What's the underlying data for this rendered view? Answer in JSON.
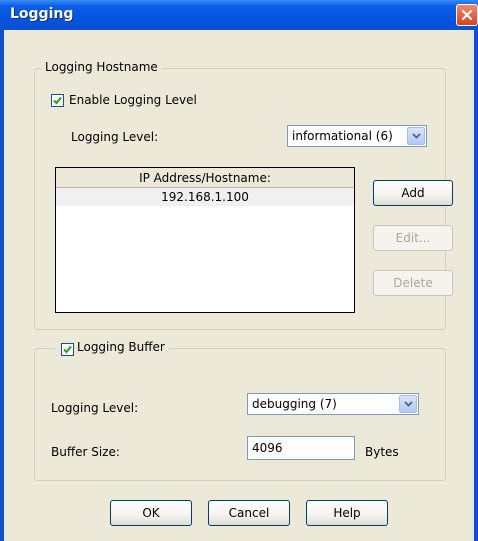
{
  "window": {
    "title": "Logging"
  },
  "hostname_group": {
    "legend": "Logging Hostname",
    "enable_label": "Enable Logging Level",
    "enable_checked": true,
    "level_label": "Logging Level:",
    "level_value": "informational (6)",
    "table": {
      "header": "IP Address/Hostname:",
      "rows": [
        "192.168.1.100"
      ]
    },
    "buttons": {
      "add": "Add",
      "edit": "Edit...",
      "delete": "Delete"
    }
  },
  "buffer_group": {
    "legend": "Logging Buffer",
    "checked": true,
    "level_label": "Logging Level:",
    "level_value": "debugging (7)",
    "size_label": "Buffer Size:",
    "size_value": "4096",
    "size_unit": "Bytes"
  },
  "footer": {
    "ok": "OK",
    "cancel": "Cancel",
    "help": "Help"
  }
}
